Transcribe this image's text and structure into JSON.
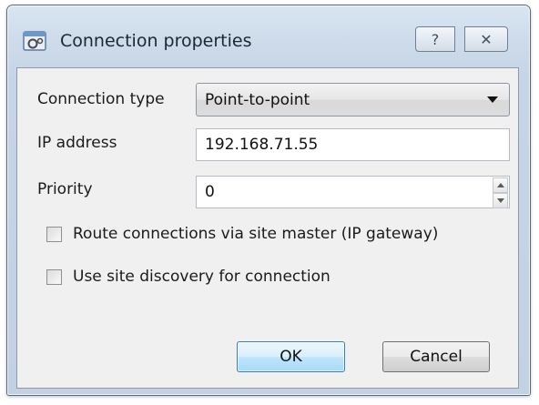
{
  "window": {
    "title": "Connection properties",
    "help_label": "?",
    "close_label": "✕"
  },
  "form": {
    "connection_type": {
      "label": "Connection type",
      "selected": "Point-to-point"
    },
    "ip_address": {
      "label": "IP address",
      "value": "192.168.71.55"
    },
    "priority": {
      "label": "Priority",
      "value": "0"
    },
    "route_via_site_master": {
      "label": "Route connections via site master (IP gateway)",
      "checked": false
    },
    "use_site_discovery": {
      "label": "Use site discovery for connection",
      "checked": false
    }
  },
  "buttons": {
    "ok_label": "OK",
    "cancel_label": "Cancel"
  },
  "colors": {
    "accent": "#3c7fb1",
    "frame": "#c6d5e6"
  }
}
